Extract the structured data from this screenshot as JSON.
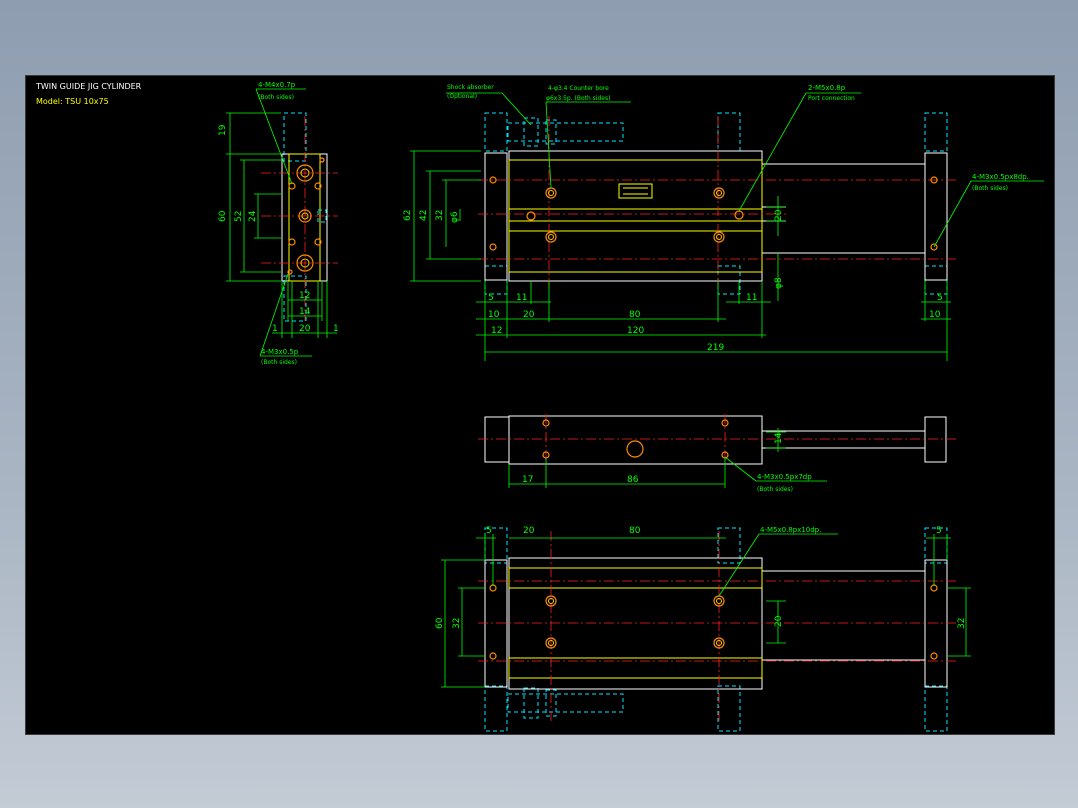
{
  "title_block": {
    "title": "TWIN GUIDE JIG CYLINDER",
    "model": "Model: TSU 10x75"
  },
  "colors": {
    "background": "#000000",
    "outline": "#ffffff",
    "dimension": "#00ff00",
    "centerline": "#ff2020",
    "hidden": "#00e5ff",
    "holes": "#ff8c00",
    "highlight": "#ffff00"
  },
  "side_view": {
    "callout_top": "4-M4x0.7p",
    "callout_top_sub": "(Both sides)",
    "callout_bottom": "4-M3x0.5p",
    "callout_bottom_sub": "(Both sides)",
    "dims": [
      "19",
      "60",
      "52",
      "24",
      "12",
      "14",
      "20",
      "1",
      "1"
    ]
  },
  "top_view": {
    "shock_label": "Shock absorber",
    "shock_sub": "(Optional)",
    "counter_bore": "4-φ3.4 Counter bore",
    "counter_bore_sub": "φ6x3.5p. (Both sides)",
    "port": "2-M5x0.8p",
    "port_sub": "Port connection",
    "end_tap": "4-M3x0.5px8dp.",
    "end_tap_sub": "(Both sides)",
    "dims": {
      "d62": "62",
      "d42": "42",
      "d32": "32",
      "d6": "φ6",
      "d20": "20",
      "d8": "φ8",
      "d5a": "5",
      "d11a": "11",
      "d11b": "11",
      "d5b": "5",
      "d20b": "20",
      "d80": "80",
      "d10a": "10",
      "d12": "12",
      "d120": "120",
      "d10b": "10",
      "d219": "219"
    }
  },
  "middle_view": {
    "callout": "4-M3x0.5px7dp",
    "callout_sub": "(Both sides)",
    "dims": {
      "d14": "14",
      "d17": "17",
      "d86": "86"
    }
  },
  "bottom_view": {
    "callout": "4-M5x0.8px10dp.",
    "dims": {
      "d5a": "5",
      "d20": "20",
      "d80": "80",
      "d5b": "5",
      "d60": "60",
      "d32a": "32",
      "d20b": "20",
      "d32b": "32"
    }
  }
}
